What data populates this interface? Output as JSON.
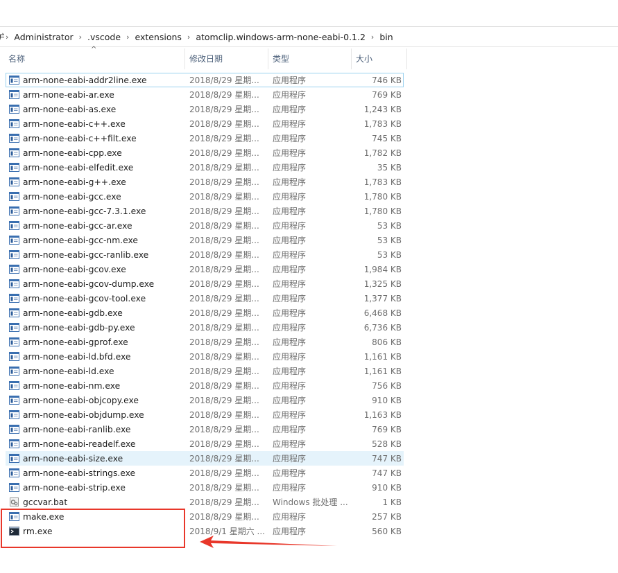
{
  "breadcrumb": {
    "head": "户",
    "items": [
      "Administrator",
      ".vscode",
      "extensions",
      "atomclip.windows-arm-none-eabi-0.1.2",
      "bin"
    ],
    "separator": "›"
  },
  "columns": {
    "name": "名称",
    "date": "修改日期",
    "type": "类型",
    "size": "大小",
    "sort_indicator": "^"
  },
  "files": [
    {
      "name": "arm-none-eabi-addr2line.exe",
      "date": "2018/8/29 星期...",
      "type": "应用程序",
      "size": "746 KB",
      "icon": "exe-icon"
    },
    {
      "name": "arm-none-eabi-ar.exe",
      "date": "2018/8/29 星期...",
      "type": "应用程序",
      "size": "769 KB",
      "icon": "exe-icon"
    },
    {
      "name": "arm-none-eabi-as.exe",
      "date": "2018/8/29 星期...",
      "type": "应用程序",
      "size": "1,243 KB",
      "icon": "exe-icon"
    },
    {
      "name": "arm-none-eabi-c++.exe",
      "date": "2018/8/29 星期...",
      "type": "应用程序",
      "size": "1,783 KB",
      "icon": "exe-icon"
    },
    {
      "name": "arm-none-eabi-c++filt.exe",
      "date": "2018/8/29 星期...",
      "type": "应用程序",
      "size": "745 KB",
      "icon": "exe-icon"
    },
    {
      "name": "arm-none-eabi-cpp.exe",
      "date": "2018/8/29 星期...",
      "type": "应用程序",
      "size": "1,782 KB",
      "icon": "exe-icon"
    },
    {
      "name": "arm-none-eabi-elfedit.exe",
      "date": "2018/8/29 星期...",
      "type": "应用程序",
      "size": "35 KB",
      "icon": "exe-icon"
    },
    {
      "name": "arm-none-eabi-g++.exe",
      "date": "2018/8/29 星期...",
      "type": "应用程序",
      "size": "1,783 KB",
      "icon": "exe-icon"
    },
    {
      "name": "arm-none-eabi-gcc.exe",
      "date": "2018/8/29 星期...",
      "type": "应用程序",
      "size": "1,780 KB",
      "icon": "exe-icon"
    },
    {
      "name": "arm-none-eabi-gcc-7.3.1.exe",
      "date": "2018/8/29 星期...",
      "type": "应用程序",
      "size": "1,780 KB",
      "icon": "exe-icon"
    },
    {
      "name": "arm-none-eabi-gcc-ar.exe",
      "date": "2018/8/29 星期...",
      "type": "应用程序",
      "size": "53 KB",
      "icon": "exe-icon"
    },
    {
      "name": "arm-none-eabi-gcc-nm.exe",
      "date": "2018/8/29 星期...",
      "type": "应用程序",
      "size": "53 KB",
      "icon": "exe-icon"
    },
    {
      "name": "arm-none-eabi-gcc-ranlib.exe",
      "date": "2018/8/29 星期...",
      "type": "应用程序",
      "size": "53 KB",
      "icon": "exe-icon"
    },
    {
      "name": "arm-none-eabi-gcov.exe",
      "date": "2018/8/29 星期...",
      "type": "应用程序",
      "size": "1,984 KB",
      "icon": "exe-icon"
    },
    {
      "name": "arm-none-eabi-gcov-dump.exe",
      "date": "2018/8/29 星期...",
      "type": "应用程序",
      "size": "1,325 KB",
      "icon": "exe-icon"
    },
    {
      "name": "arm-none-eabi-gcov-tool.exe",
      "date": "2018/8/29 星期...",
      "type": "应用程序",
      "size": "1,377 KB",
      "icon": "exe-icon"
    },
    {
      "name": "arm-none-eabi-gdb.exe",
      "date": "2018/8/29 星期...",
      "type": "应用程序",
      "size": "6,468 KB",
      "icon": "exe-icon"
    },
    {
      "name": "arm-none-eabi-gdb-py.exe",
      "date": "2018/8/29 星期...",
      "type": "应用程序",
      "size": "6,736 KB",
      "icon": "exe-icon"
    },
    {
      "name": "arm-none-eabi-gprof.exe",
      "date": "2018/8/29 星期...",
      "type": "应用程序",
      "size": "806 KB",
      "icon": "exe-icon"
    },
    {
      "name": "arm-none-eabi-ld.bfd.exe",
      "date": "2018/8/29 星期...",
      "type": "应用程序",
      "size": "1,161 KB",
      "icon": "exe-icon"
    },
    {
      "name": "arm-none-eabi-ld.exe",
      "date": "2018/8/29 星期...",
      "type": "应用程序",
      "size": "1,161 KB",
      "icon": "exe-icon"
    },
    {
      "name": "arm-none-eabi-nm.exe",
      "date": "2018/8/29 星期...",
      "type": "应用程序",
      "size": "756 KB",
      "icon": "exe-icon"
    },
    {
      "name": "arm-none-eabi-objcopy.exe",
      "date": "2018/8/29 星期...",
      "type": "应用程序",
      "size": "910 KB",
      "icon": "exe-icon"
    },
    {
      "name": "arm-none-eabi-objdump.exe",
      "date": "2018/8/29 星期...",
      "type": "应用程序",
      "size": "1,163 KB",
      "icon": "exe-icon"
    },
    {
      "name": "arm-none-eabi-ranlib.exe",
      "date": "2018/8/29 星期...",
      "type": "应用程序",
      "size": "769 KB",
      "icon": "exe-icon"
    },
    {
      "name": "arm-none-eabi-readelf.exe",
      "date": "2018/8/29 星期...",
      "type": "应用程序",
      "size": "528 KB",
      "icon": "exe-icon"
    },
    {
      "name": "arm-none-eabi-size.exe",
      "date": "2018/8/29 星期...",
      "type": "应用程序",
      "size": "747 KB",
      "icon": "exe-icon",
      "highlighted": true
    },
    {
      "name": "arm-none-eabi-strings.exe",
      "date": "2018/8/29 星期...",
      "type": "应用程序",
      "size": "747 KB",
      "icon": "exe-icon"
    },
    {
      "name": "arm-none-eabi-strip.exe",
      "date": "2018/8/29 星期...",
      "type": "应用程序",
      "size": "910 KB",
      "icon": "exe-icon"
    },
    {
      "name": "gccvar.bat",
      "date": "2018/8/29 星期...",
      "type": "Windows 批处理 ...",
      "size": "1 KB",
      "icon": "bat-icon"
    },
    {
      "name": "make.exe",
      "date": "2018/8/29 星期...",
      "type": "应用程序",
      "size": "257 KB",
      "icon": "exe-icon"
    },
    {
      "name": "rm.exe",
      "date": "2018/9/1 星期六 ...",
      "type": "应用程序",
      "size": "560 KB",
      "icon": "console-exe-icon"
    }
  ],
  "colors": {
    "annotation": "#e8372a",
    "highlight": "#e5f3fb",
    "focus_border": "#99d1ef",
    "header_text": "#4c607a"
  }
}
